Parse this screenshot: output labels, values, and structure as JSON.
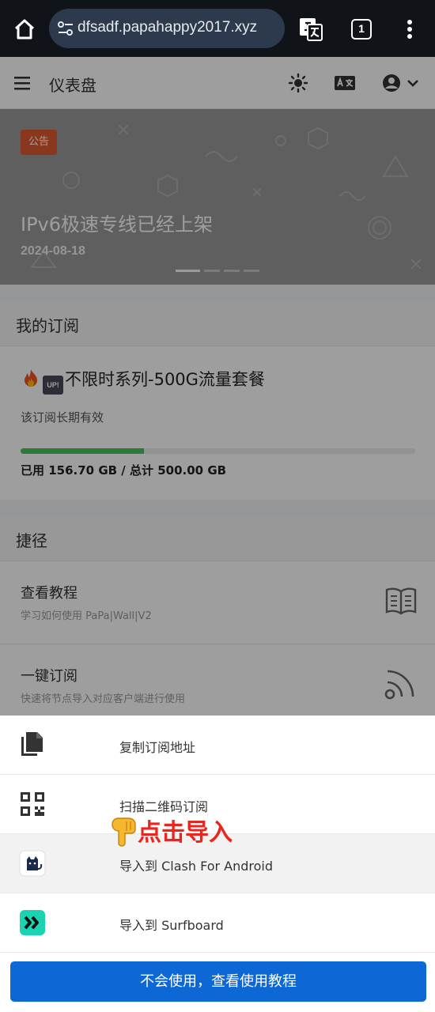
{
  "browser": {
    "url": "dfsadf.papahappy2017.xyz",
    "tab_count": "1"
  },
  "header": {
    "title": "仪表盘"
  },
  "banner": {
    "badge": "公告",
    "title": "IPv6极速专线已经上架",
    "date": "2024-08-18",
    "active_slide": 1,
    "slide_count": 4
  },
  "subscription": {
    "card_title": "我的订阅",
    "plan_name": "不限时系列-500G流量套餐",
    "validity": "该订阅长期有效",
    "usage_text": "已用 156.70 GB / 总计 500.00 GB",
    "used_fraction": 0.3134
  },
  "shortcuts": {
    "card_title": "捷径",
    "items": [
      {
        "title": "查看教程",
        "subtitle": "学习如何使用 PaPa|Wall|V2",
        "icon": "book-icon"
      },
      {
        "title": "一键订阅",
        "subtitle": "快速将节点导入对应客户端进行使用",
        "icon": "rss-icon"
      }
    ]
  },
  "sheet": {
    "items": [
      {
        "label": "复制订阅地址",
        "icon": "copy-icon"
      },
      {
        "label": "扫描二维码订阅",
        "icon": "qr-code-icon"
      },
      {
        "label": "导入到 Clash For Android",
        "icon": "clash-icon"
      },
      {
        "label": "导入到 Surfboard",
        "icon": "surfboard-icon"
      }
    ],
    "tutorial_button": "不会使用，查看使用教程"
  },
  "annotation": {
    "text": "点击导入"
  },
  "colors": {
    "primary_button": "#0d67d4",
    "progress": "#46c35f",
    "badge": "#e05a2f",
    "annotation": "#e8261f"
  }
}
